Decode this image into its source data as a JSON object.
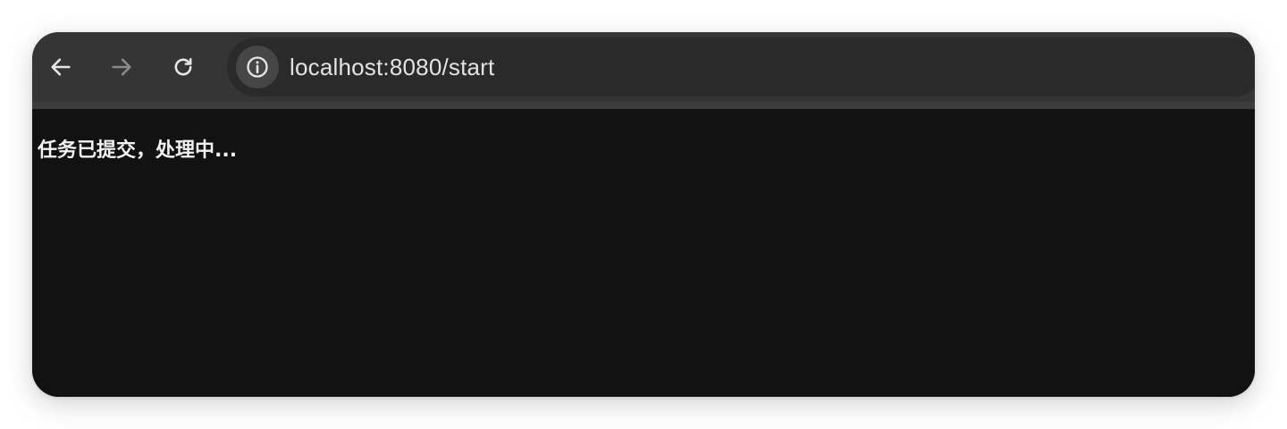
{
  "browser": {
    "toolbar": {
      "back_icon": "arrow-left-icon",
      "forward_icon": "arrow-right-icon",
      "reload_icon": "reload-icon",
      "site_info_icon": "info-icon"
    },
    "address_bar": {
      "url": "localhost:8080/start"
    }
  },
  "page": {
    "status_text": "任务已提交，处理中..."
  },
  "colors": {
    "toolbar_bg": "#353535",
    "omnibox_bg": "#2a2a2a",
    "page_bg": "#121212",
    "text": "#f2f2f2"
  }
}
